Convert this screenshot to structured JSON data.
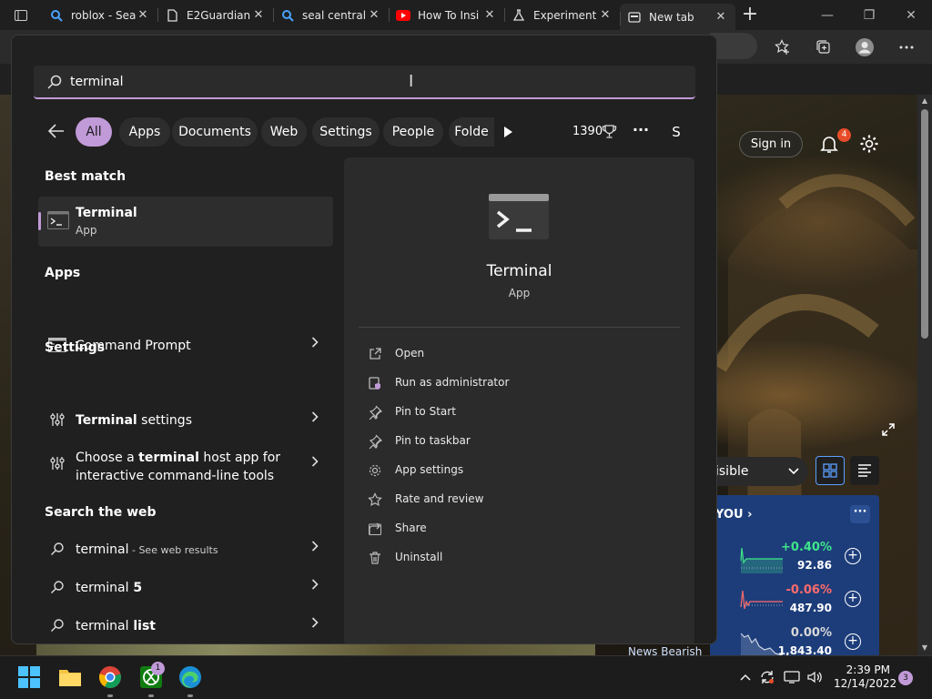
{
  "browser": {
    "tabs": [
      {
        "title": "roblox - Sea",
        "favicon": "search-favicon",
        "active": false
      },
      {
        "title": "E2Guardian",
        "favicon": "document-favicon",
        "active": false
      },
      {
        "title": "seal central",
        "favicon": "search-favicon",
        "active": false
      },
      {
        "title": "How To Insi",
        "favicon": "youtube-favicon",
        "active": false
      },
      {
        "title": "Experiment",
        "favicon": "flask-favicon",
        "active": false
      },
      {
        "title": "New tab",
        "favicon": "newtab-favicon",
        "active": true
      }
    ],
    "newtab_symbol": "+",
    "close_symbol": "✕"
  },
  "new_tab_page": {
    "signin_label": "Sign in",
    "notification_count": "4",
    "feed_filter_label": "isible",
    "finance": {
      "header": "YOU",
      "more": "···",
      "rows": [
        {
          "change": "+0.40%",
          "price": "92.86",
          "trend": "up",
          "color": "#3ee68a"
        },
        {
          "change": "-0.06%",
          "price": "487.90",
          "trend": "down",
          "color": "#ff6b6b"
        },
        {
          "change": "0.00%",
          "price": "1,843.40",
          "trend": "flat",
          "color": "#d8d8d8"
        }
      ],
      "news_label": "News Bearish"
    }
  },
  "search": {
    "query": "terminal",
    "filters": [
      {
        "label": "All",
        "active": true
      },
      {
        "label": "Apps",
        "active": false
      },
      {
        "label": "Documents",
        "active": false
      },
      {
        "label": "Web",
        "active": false
      },
      {
        "label": "Settings",
        "active": false
      },
      {
        "label": "People",
        "active": false
      },
      {
        "label": "Folde",
        "active": false
      }
    ],
    "points": "1390",
    "more_label": "···",
    "account_initial": "S",
    "sections": {
      "best_match": "Best match",
      "apps": "Apps",
      "settings": "Settings",
      "web": "Search the web"
    },
    "best_match": {
      "name": "Terminal",
      "type": "App"
    },
    "apps": [
      {
        "name": "Command Prompt"
      }
    ],
    "settings": [
      {
        "bold": "Terminal",
        "rest": " settings"
      },
      {
        "pre": "Choose a ",
        "bold": "terminal",
        "rest": " host app for",
        "line2": "interactive command-line tools"
      }
    ],
    "web": [
      {
        "query": "terminal",
        "suffix": " - See web results"
      },
      {
        "query": "terminal",
        "bold": " 5"
      },
      {
        "query": "terminal",
        "bold": " list"
      }
    ],
    "detail": {
      "name": "Terminal",
      "type": "App",
      "actions": [
        {
          "label": "Open",
          "icon": "open-external-icon"
        },
        {
          "label": "Run as administrator",
          "icon": "shield-admin-icon"
        },
        {
          "label": "Pin to Start",
          "icon": "pin-icon"
        },
        {
          "label": "Pin to taskbar",
          "icon": "pin-icon"
        },
        {
          "label": "App settings",
          "icon": "gear-icon"
        },
        {
          "label": "Rate and review",
          "icon": "star-icon"
        },
        {
          "label": "Share",
          "icon": "share-icon"
        },
        {
          "label": "Uninstall",
          "icon": "trash-icon"
        }
      ]
    }
  },
  "taskbar": {
    "xbox_badge": "1",
    "time": "2:39 PM",
    "date": "12/14/2022",
    "notification_count": "3"
  },
  "colors": {
    "accent": "#c19ad8",
    "panel": "#202020",
    "detail_panel": "#2b2b2b",
    "finance_card": "#1d3d7a"
  }
}
